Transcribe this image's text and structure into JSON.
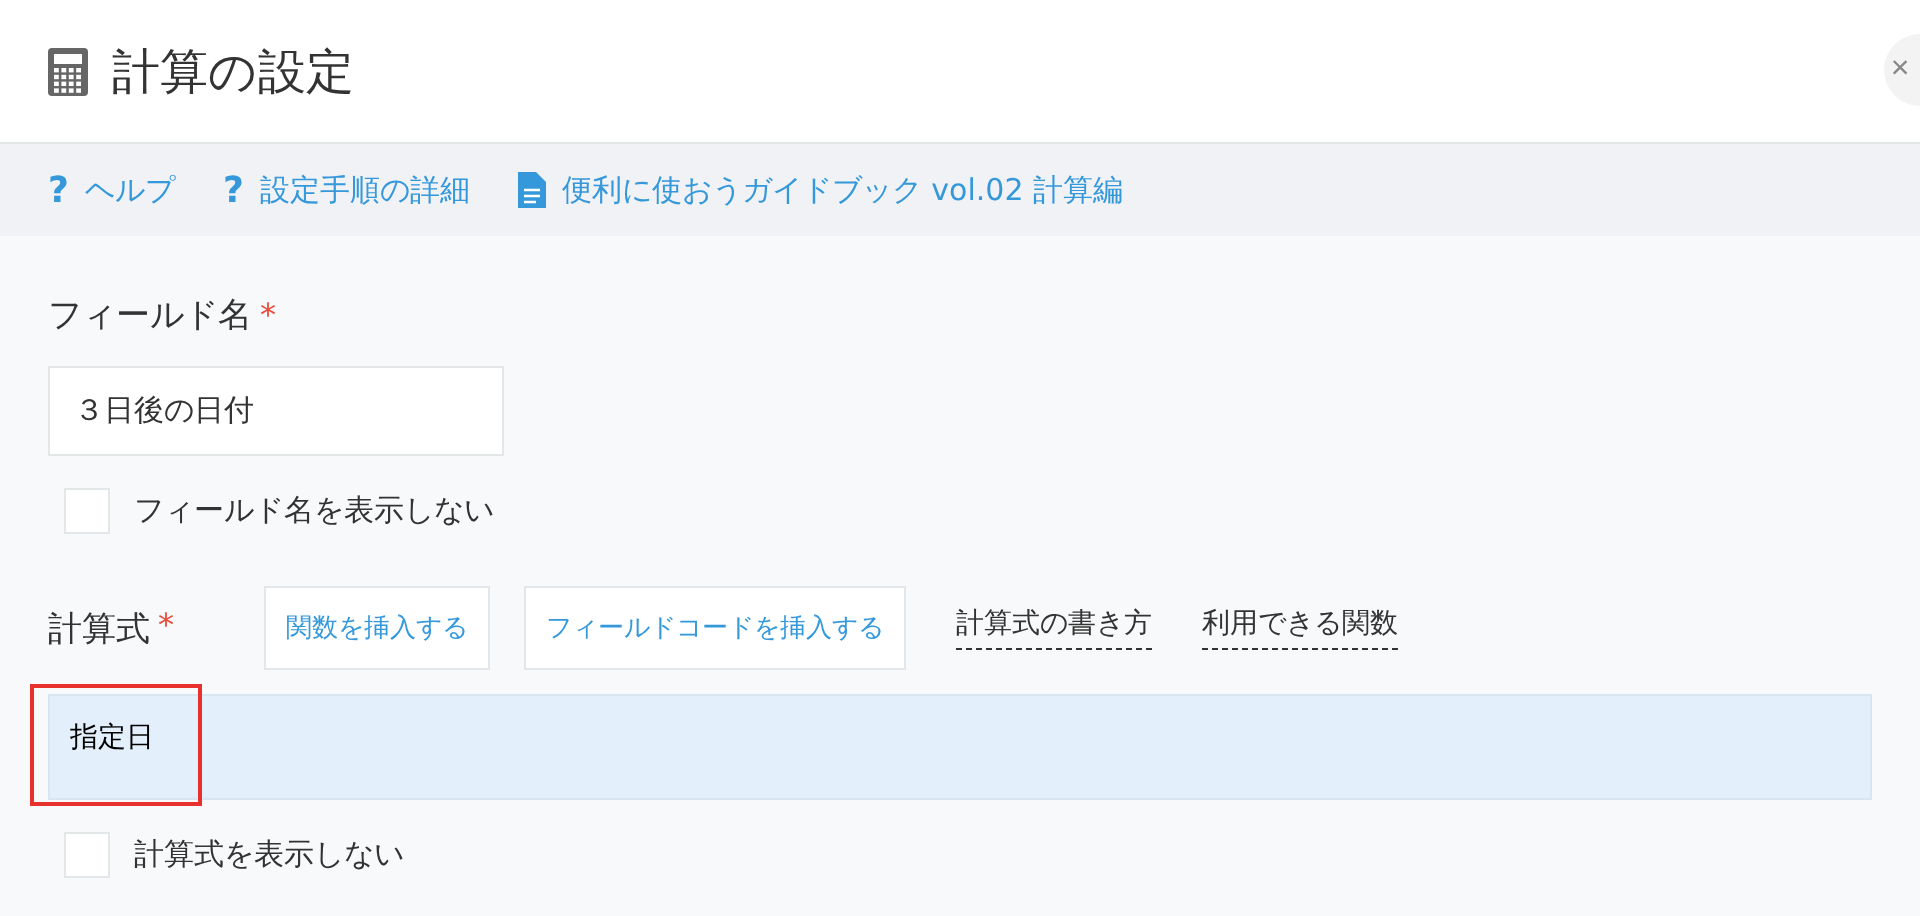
{
  "dialog": {
    "title": "計算の設定",
    "close": "×"
  },
  "links": [
    {
      "kind": "help",
      "icon": "?",
      "label": "ヘルプ"
    },
    {
      "kind": "help",
      "icon": "?",
      "label": "設定手順の詳細"
    },
    {
      "kind": "document",
      "label": "便利に使おうガイドブック vol.02 計算編"
    }
  ],
  "field_name": {
    "label": "フィールド名",
    "required_mark": "*",
    "value": "３日後の日付",
    "hide_checkbox": {
      "label": "フィールド名を表示しない",
      "checked": false
    }
  },
  "formula": {
    "label": "計算式",
    "required_mark": "*",
    "buttons": [
      "関数を挿入する",
      "フィールドコードを挿入する"
    ],
    "help_links": [
      "計算式の書き方",
      "利用できる関数"
    ],
    "value": "指定日",
    "highlighted": true,
    "hide_checkbox": {
      "label": "計算式を表示しない",
      "checked": false
    }
  }
}
